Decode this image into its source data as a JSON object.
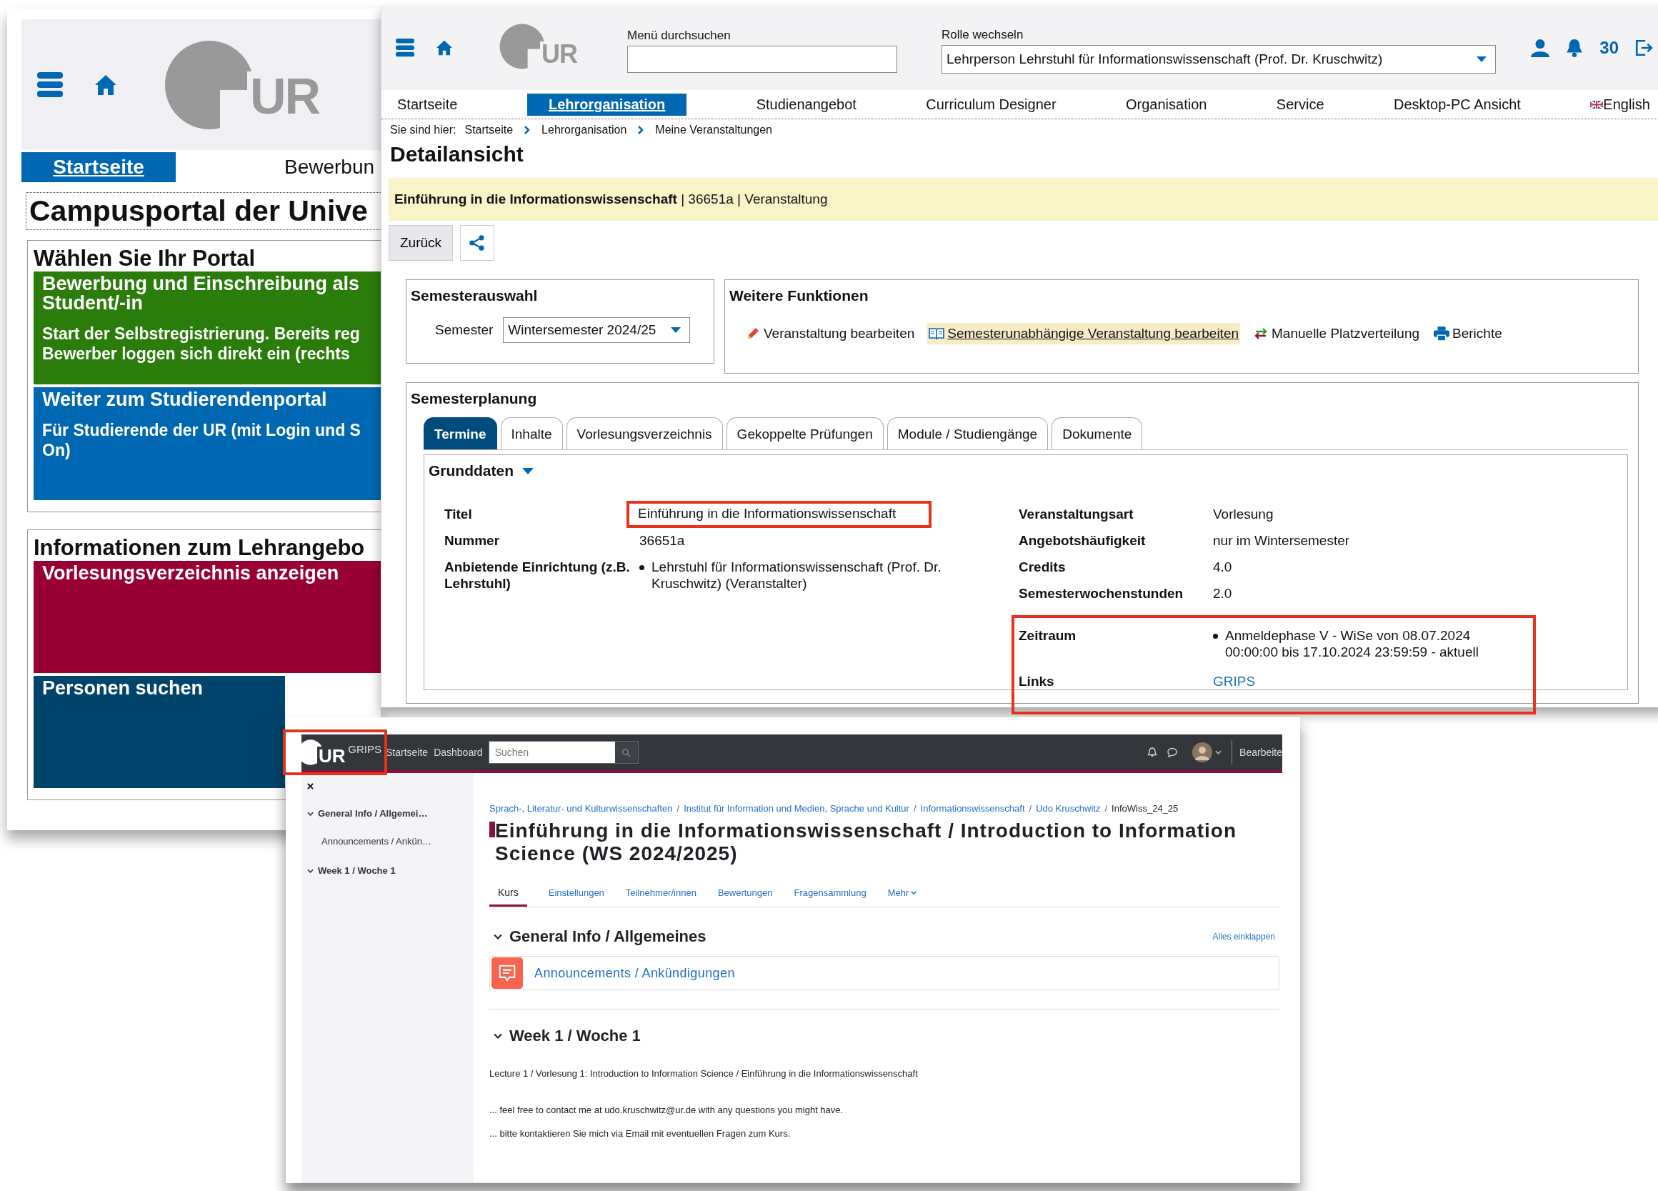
{
  "portal_window": {
    "logo_text": "UR",
    "nav_tabs": [
      {
        "label": "Startseite",
        "selected": true
      },
      {
        "label": "Bewerbun",
        "selected": false
      }
    ],
    "title": "Campusportal der Unive",
    "sections": [
      {
        "heading": "Wählen Sie Ihr Portal",
        "tiles": [
          {
            "color": "#2b7d0b",
            "title_lines": [
              "Bewerbung und Einschreibung als",
              "Student/-in"
            ],
            "text_lines": [
              "Start der Selbstregistrierung. Bereits reg",
              "Bewerber loggen sich direkt ein (rechts"
            ]
          },
          {
            "color": "#0068b3",
            "title_lines": [
              "Weiter zum Studierendenportal"
            ],
            "text_lines": [
              "Für Studierende der UR (mit Login und S",
              "On)"
            ]
          }
        ]
      },
      {
        "heading": "Informationen zum Lehrangebo",
        "tiles": [
          {
            "color": "#990033",
            "title_lines": [
              "Vorlesungsverzeichnis anzeigen"
            ]
          },
          {
            "color": "#00436b",
            "title_lines": [
              "Personen suchen"
            ]
          }
        ]
      }
    ]
  },
  "course_window": {
    "logo_text": "UR",
    "search_label": "Menü durchsuchen",
    "role_label": "Rolle wechseln",
    "role_value": "Lehrperson Lehrstuhl für Informationswissenschaft (Prof. Dr. Kruschwitz)",
    "notification_count": "30",
    "menu": [
      {
        "label": "Startseite",
        "selected": false
      },
      {
        "label": "Lehrorganisation",
        "selected": true
      },
      {
        "label": "Studienangebot",
        "selected": false
      },
      {
        "label": "Curriculum Designer",
        "selected": false
      },
      {
        "label": "Organisation",
        "selected": false
      },
      {
        "label": "Service",
        "selected": false
      },
      {
        "label": "Desktop-PC Ansicht",
        "selected": false
      }
    ],
    "language": "English",
    "breadcrumb_label": "Sie sind hier:",
    "breadcrumb": [
      "Startseite",
      "Lehrorganisation",
      "Meine Veranstaltungen"
    ],
    "page_title": "Detailansicht",
    "banner": "**Einführung in die Informationswissenschaft** | 36651a | Veranstaltung",
    "back_button": "Zurück",
    "semester_box": {
      "heading": "Semesterauswahl",
      "label": "Semester",
      "value": "Wintersemester 2024/25"
    },
    "functions": {
      "heading": "Weitere Funktionen",
      "items": [
        {
          "kind": "pencil",
          "label": "Veranstaltung bearbeiten",
          "highlighted": false
        },
        {
          "kind": "book",
          "label": "Semesterunabhängige Veranstaltung bearbeiten",
          "highlighted": true
        },
        {
          "kind": "arrows",
          "label": "Manuelle Platzverteilung",
          "highlighted": false
        },
        {
          "kind": "printer",
          "label": "Berichte",
          "highlighted": false
        }
      ]
    },
    "planning": {
      "heading": "Semesterplanung",
      "tabs": [
        {
          "label": "Termine",
          "selected": true
        },
        {
          "label": "Inhalte",
          "selected": false
        },
        {
          "label": "Vorlesungsverzeichnis",
          "selected": false
        },
        {
          "label": "Gekoppelte Prüfungen",
          "selected": false
        },
        {
          "label": "Module / Studiengänge",
          "selected": false
        },
        {
          "label": "Dokumente",
          "selected": false
        }
      ],
      "section": {
        "title": "Grunddaten",
        "expanded": true,
        "left_rows": [
          {
            "kind": "text",
            "label": "Titel",
            "value": "Einführung in die Informationswissenschaft",
            "highlighted": true
          },
          {
            "kind": "text",
            "label": "Nummer",
            "value": "36651a",
            "highlighted": false
          },
          {
            "kind": "bullets",
            "label": "Anbietende Einrichtung (z.B. Lehrstuhl)",
            "bullets": [
              "Lehrstuhl für Informationswissenschaft (Prof. Dr. Kruschwitz) (Veranstalter)"
            ],
            "highlighted": false
          }
        ],
        "right_rows": [
          {
            "kind": "text",
            "label": "Veranstaltungsart",
            "value": "Vorlesung",
            "highlighted": false
          },
          {
            "kind": "text",
            "label": "Angebotshäufigkeit",
            "value": "nur im Wintersemester",
            "highlighted": false
          },
          {
            "kind": "text",
            "label": "Credits",
            "value": "4.0",
            "highlighted": false
          },
          {
            "kind": "text",
            "label": "Semesterwochenstunden",
            "value": "2.0",
            "highlighted": false
          },
          {
            "kind": "bullets",
            "label": "Zeitraum",
            "bullets": [
              "Anmeldephase V - WiSe von 08.07.2024 00:00:00 bis 17.10.2024 23:59:59 - aktuell"
            ],
            "highlighted": true
          },
          {
            "kind": "link",
            "label": "Links",
            "value": "GRIPS",
            "highlighted": true
          }
        ]
      }
    }
  },
  "lms_window": {
    "logo_text": "UR",
    "logo_label": "GRIPS",
    "logo_highlighted": true,
    "nav": [
      "Startseite",
      "Dashboard"
    ],
    "search_placeholder": "Suchen",
    "edit_label": "Bearbeite",
    "sidebar": [
      {
        "label": "General Info / Allgemei…",
        "expanded": true,
        "children": [
          {
            "label": "Announcements / Ankün…"
          }
        ]
      },
      {
        "label": "Week 1 / Woche 1",
        "expanded": true
      }
    ],
    "breadcrumb_separator": "/",
    "breadcrumb": [
      "Sprach-, Literatur- und Kulturwissenschaften",
      "Institut für Information und Medien, Sprache und Kultur",
      "Informationswissenschaft",
      "Udo Kruschwitz",
      "InfoWiss_24_25"
    ],
    "title": "Einführung in die Informationswissenschaft / Introduction to Information Science (WS 2024/2025)",
    "tabs": [
      {
        "label": "Kurs",
        "selected": true
      },
      {
        "label": "Einstellungen",
        "selected": false
      },
      {
        "label": "Teilnehmer/innen",
        "selected": false
      },
      {
        "label": "Bewertungen",
        "selected": false
      },
      {
        "label": "Fragensammlung",
        "selected": false
      },
      {
        "label": "Mehr",
        "selected": false
      }
    ],
    "collapse_all": "Alles einklappen",
    "sections": [
      {
        "title": "General Info / Allgemeines",
        "expanded": true,
        "activities": [
          "Announcements / Ankündigungen"
        ]
      },
      {
        "title": "Week 1 / Woche 1",
        "expanded": true,
        "paragraphs": [
          "Lecture 1 / Vorlesung 1: Introduction to Information Science / Einführung in die Informationswissenschaft",
          "... feel free to contact me at udo.kruschwitz@ur.de with any questions you might have.",
          "... bitte kontaktieren Sie mich via Email mit eventuellen Fragen zum Kurs."
        ]
      }
    ]
  }
}
